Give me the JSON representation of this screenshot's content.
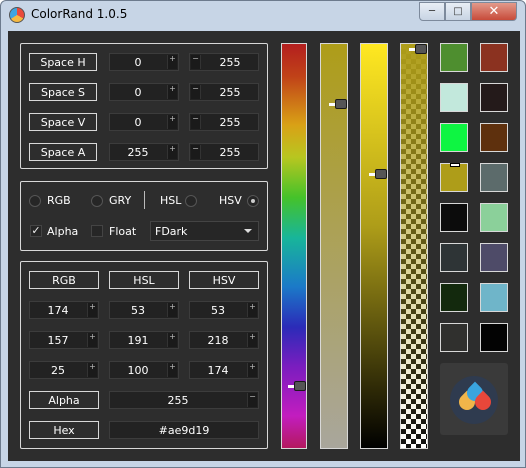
{
  "window": {
    "title": "ColorRand 1.0.5",
    "minimize": "─",
    "maximize": "□",
    "close": "✕"
  },
  "space_rows": [
    {
      "label": "Space H",
      "min": "0",
      "max": "255"
    },
    {
      "label": "Space S",
      "min": "0",
      "max": "255"
    },
    {
      "label": "Space V",
      "min": "0",
      "max": "255"
    },
    {
      "label": "Space A",
      "min": "255",
      "max": "255"
    }
  ],
  "modes": {
    "items": [
      "RGB",
      "GRY",
      "HSL",
      "HSV"
    ],
    "selected": "HSV",
    "alpha_label": "Alpha",
    "alpha_checked": true,
    "float_label": "Float",
    "float_checked": false,
    "theme": "FDark",
    "check_glyph": "✓"
  },
  "values": {
    "headers": [
      "RGB",
      "HSL",
      "HSV"
    ],
    "rows": [
      [
        "174",
        "53",
        "53"
      ],
      [
        "157",
        "191",
        "218"
      ],
      [
        "25",
        "100",
        "174"
      ]
    ],
    "alpha_label": "Alpha",
    "alpha_value": "255",
    "hex_label": "Hex",
    "hex_value": "#ae9d19"
  },
  "spin_glyphs": {
    "plus": "+",
    "minus": "−"
  },
  "colors": {
    "current": "#ae9d19",
    "swatches_left": [
      "#4e8e2f",
      "#c2e8dc",
      "#0ef542",
      "#ae9d19",
      "#0c0c0c",
      "#2e3436",
      "#13290d",
      "#30302e"
    ],
    "swatches_right": [
      "#8b3220",
      "#241a1a",
      "#5e300d",
      "#5c6b6b",
      "#8bd09a",
      "#4e4b68",
      "#6fb5c9",
      "#030303"
    ]
  },
  "sliders": {
    "hue": 0.14,
    "saturation": 0.86,
    "value": 0.68,
    "alpha": 1.0
  },
  "icons": {
    "logo": "colorrand-drops-icon",
    "app": "colorrand-app-icon"
  }
}
